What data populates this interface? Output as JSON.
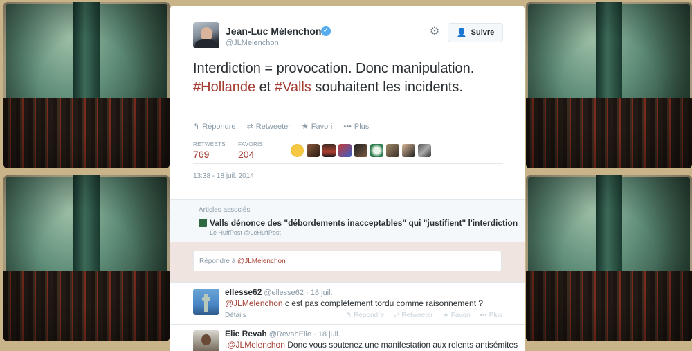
{
  "tweet": {
    "fullname": "Jean-Luc Mélenchon",
    "screen_name": "@JLMelenchon",
    "follow_label": "Suivre",
    "text_part1": "Interdiction = provocation. Donc manipulation. ",
    "hashtag1": "#Hollande",
    "text_part2": " et ",
    "hashtag2": "#Valls",
    "text_part3": " souhaitent les incidents.",
    "actions": {
      "reply": "Répondre",
      "retweet": "Retweeter",
      "favorite": "Favori",
      "more": "Plus"
    },
    "stats": {
      "retweets_label": "RETWEETS",
      "retweets": "769",
      "favorites_label": "FAVORIS",
      "favorites": "204"
    },
    "timestamp": "13:38 - 18 juil. 2014"
  },
  "related": {
    "title": "Articles associés",
    "headline": "Valls dénonce des \"débordements inacceptables\" qui \"justifient\" l'interdiction",
    "source": "Le HuffPost @LeHuffPost"
  },
  "reply_box": {
    "prefix": "Répondre à ",
    "mention": "@JLMelenchon"
  },
  "replies": [
    {
      "name": "ellesse62",
      "handle": "@ellesse62",
      "time": "· 18 juil.",
      "mention": "@JLMelenchon",
      "text": " c est pas complètement tordu comme raisonnement ?",
      "details": "Détails",
      "actions": [
        "Répondre",
        "Retweeter",
        "Favori",
        "Plus"
      ]
    },
    {
      "name": "Elie Revah",
      "handle": "@RevahElie",
      "time": "· 18 juil.",
      "mention": ".@JLMelenchon",
      "text": " Donc vous soutenez une manifestation aux relents antisémites"
    }
  ],
  "colors": {
    "hashtag": "#a33c31",
    "link": "#a33c31",
    "verified": "#55acee",
    "muted": "#8899a6"
  },
  "icons": {
    "verified": "verified-badge-icon",
    "gear": "gear-icon",
    "follow": "add-user-icon",
    "reply": "reply-icon",
    "retweet": "retweet-icon",
    "favorite": "star-icon",
    "more": "more-dots-icon"
  }
}
